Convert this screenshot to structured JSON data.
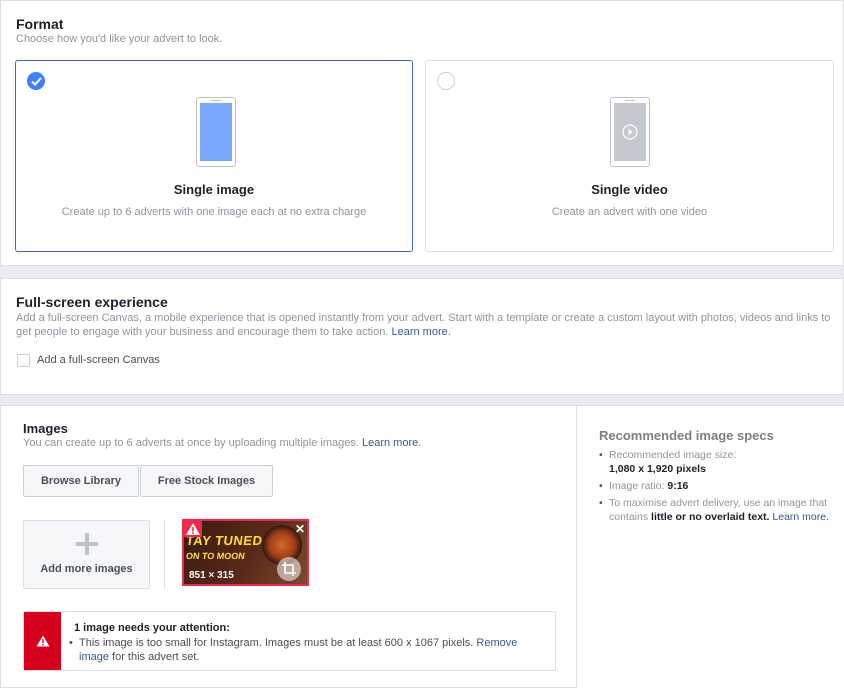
{
  "format": {
    "title": "Format",
    "subtitle": "Choose how you'd like your advert to look.",
    "options": [
      {
        "title": "Single image",
        "desc": "Create up to 6 adverts with one image each at no extra charge",
        "selected": true
      },
      {
        "title": "Single video",
        "desc": "Create an advert with one video",
        "selected": false
      }
    ]
  },
  "fullscreen": {
    "title": "Full-screen experience",
    "desc": "Add a full-screen Canvas, a mobile experience that is opened instantly from your advert. Start with a template or create a custom layout with photos, videos and links to get people to engage with your business and encourage them to take action.",
    "learn_more": "Learn more.",
    "checkbox_label": "Add a full-screen Canvas"
  },
  "images": {
    "title": "Images",
    "subtitle": "You can create up to 6 adverts at once by uploading multiple images.",
    "learn_more": "Learn more.",
    "browse_label": "Browse Library",
    "stock_label": "Free Stock Images",
    "add_more_label": "Add more images",
    "thumbnail": {
      "line1": "TAY TUNED",
      "line2": "ON TO MOON",
      "dims": "851 × 315"
    },
    "alert": {
      "title": "1 image needs your attention:",
      "body": "This image is too small for Instagram. Images must be at least 600 x 1067 pixels.",
      "remove": "Remove image",
      "suffix": "for this advert set."
    }
  },
  "specs": {
    "title": "Recommended image specs",
    "size_label": "Recommended image size:",
    "size_value": "1,080 x 1,920 pixels",
    "ratio_label": "Image ratio:",
    "ratio_value": "9:16",
    "delivery_text": "To maximise advert delivery, use an image that contains",
    "delivery_bold": "little or no overlaid text.",
    "learn_more": "Learn more."
  },
  "colors": {
    "accent": "#4267b2",
    "link": "#365899",
    "error": "#d6001c",
    "phone_screen": "#7aa7ff"
  }
}
